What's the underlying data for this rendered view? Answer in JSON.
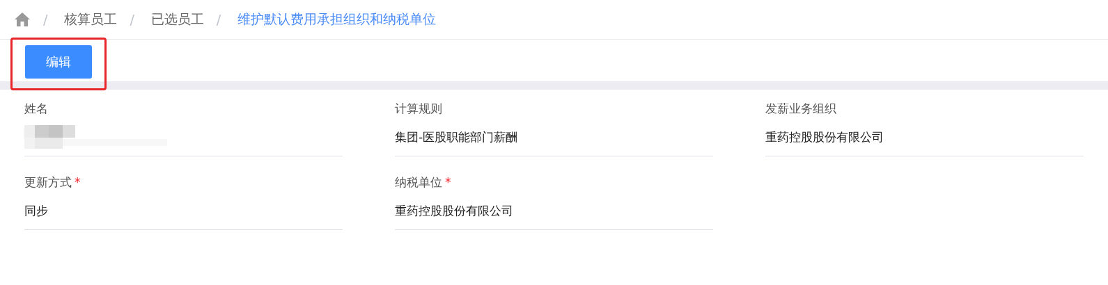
{
  "breadcrumb": [
    {
      "separator": "/",
      "label": "核算员工",
      "current": false
    },
    {
      "separator": "/",
      "label": "已选员工",
      "current": false
    },
    {
      "separator": "/",
      "label": "维护默认费用承担组织和纳税单位",
      "current": true
    }
  ],
  "toolbar": {
    "edit_button": {
      "label": "编辑",
      "highlighted": true
    }
  },
  "form": {
    "fields": [
      {
        "label": "姓名",
        "kind": "redacted"
      },
      {
        "label": "计算规则",
        "kind": "text",
        "value": "集团-医股职能部门薪酬"
      },
      {
        "label": "发薪业务组织",
        "kind": "text",
        "value": "重药控股股份有限公司"
      },
      {
        "label": "更新方式",
        "required_mark": "*",
        "kind": "text",
        "value": "同步"
      },
      {
        "label": "纳税单位",
        "required_mark": "*",
        "kind": "text",
        "value": "重药控股股份有限公司"
      }
    ]
  }
}
